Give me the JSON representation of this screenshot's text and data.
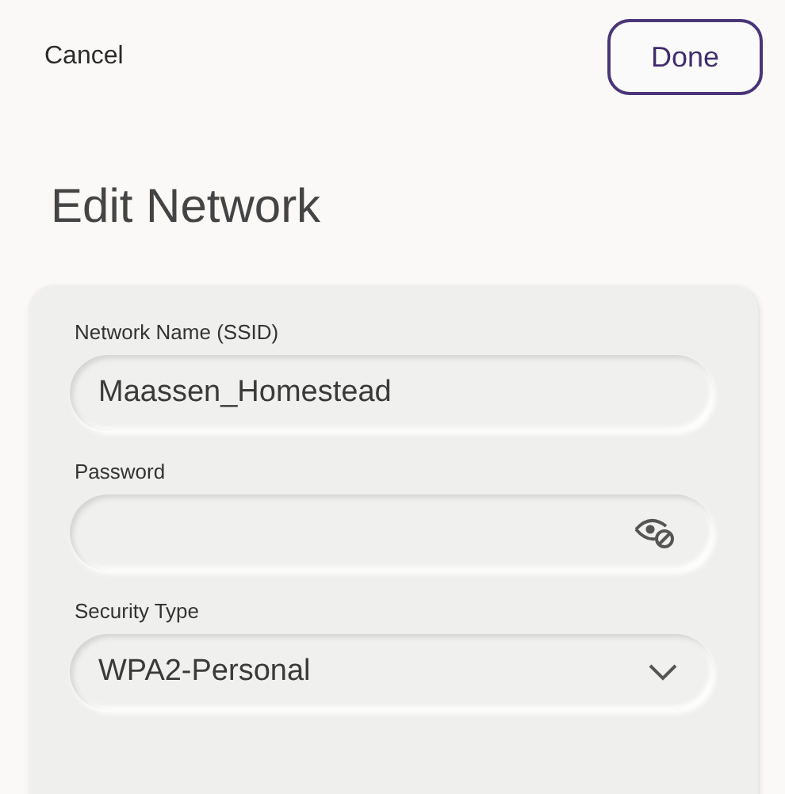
{
  "header": {
    "cancel": "Cancel",
    "done": "Done"
  },
  "title": "Edit Network",
  "fields": [
    {
      "kind": "text",
      "label": "Network Name (SSID)",
      "value": "Maassen_Homestead"
    },
    {
      "kind": "password",
      "label": "Password"
    },
    {
      "kind": "select",
      "label": "Security Type",
      "value": "WPA2-Personal"
    }
  ]
}
